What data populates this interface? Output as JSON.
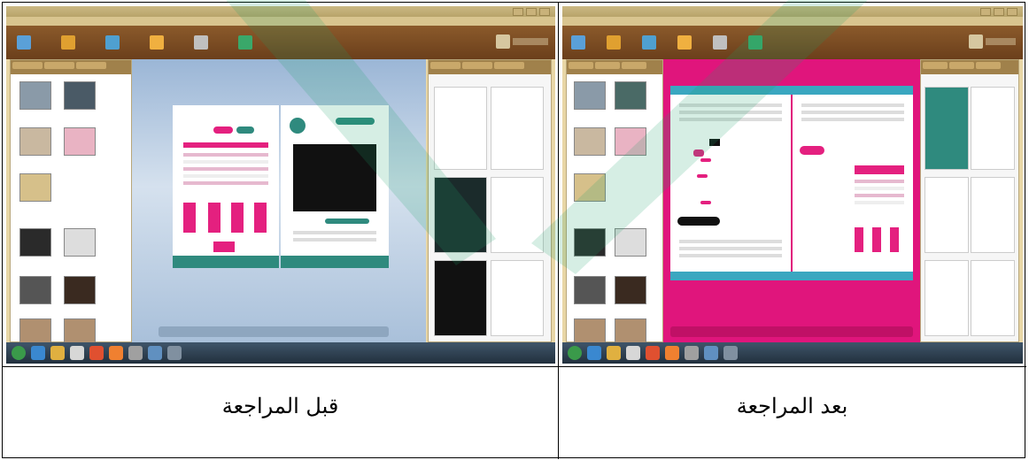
{
  "captions": {
    "before": "قبل المراجعة",
    "after": "بعد المراجعة"
  },
  "colors": {
    "toolbar": "#7a4a22",
    "accent_pink": "#e4207f",
    "accent_teal": "#2f8a7e",
    "taskbar": "#2c3b4a",
    "watermark_green": "#1aa36b"
  },
  "screenshots": [
    {
      "name": "before-revision",
      "background": "sky-blue canvas"
    },
    {
      "name": "after-revision",
      "background": "pink canvas"
    }
  ]
}
